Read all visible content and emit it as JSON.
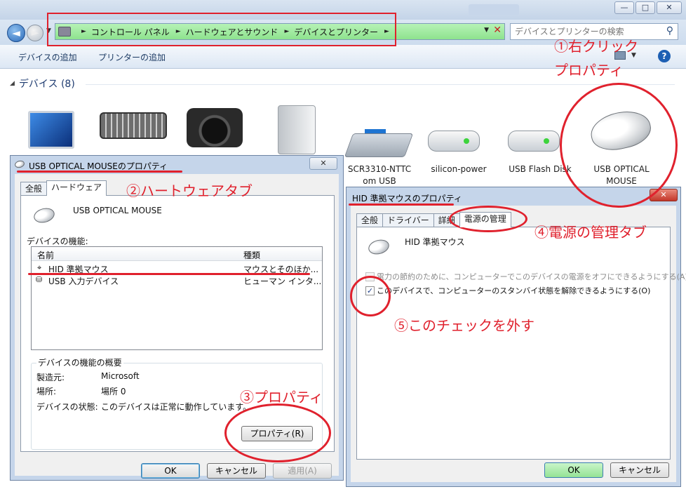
{
  "explorer": {
    "address_crumbs": [
      "コントロール パネル",
      "ハードウェアとサウンド",
      "デバイスとプリンター"
    ],
    "search_placeholder": "デバイスとプリンターの検索",
    "toolbar": {
      "add_device": "デバイスの追加",
      "add_printer": "プリンターの追加"
    },
    "caption": {
      "minimize": "—",
      "maximize": "□",
      "close": "✕"
    },
    "devices_header": "デバイス (8)",
    "devices": [
      {
        "name": "",
        "icon": "monitor-icon"
      },
      {
        "name": "",
        "icon": "keyboard-icon"
      },
      {
        "name": "",
        "icon": "camera-icon"
      },
      {
        "name": "",
        "icon": "external-drive-icon"
      },
      {
        "name": "SCR3310-NTTC\nom USB",
        "icon": "card-reader-icon"
      },
      {
        "name": "silicon-power",
        "icon": "usb-drive-icon"
      },
      {
        "name": "USB Flash Disk",
        "icon": "usb-drive-icon"
      },
      {
        "name": "USB OPTICAL\nMOUSE",
        "icon": "mouse-icon"
      }
    ]
  },
  "dialog1": {
    "title": "USB OPTICAL MOUSEのプロパティ",
    "close": "✕",
    "tabs": [
      "全般",
      "ハードウェア"
    ],
    "device_name": "USB OPTICAL MOUSE",
    "functions_label": "デバイスの機能:",
    "columns": [
      "名前",
      "種類"
    ],
    "rows": [
      {
        "name": "HID 準拠マウス",
        "type": "マウスとそのほか..."
      },
      {
        "name": "USB 入力デバイス",
        "type": "ヒューマン インタ..."
      }
    ],
    "summary_label": "デバイスの機能の概要",
    "summary": [
      {
        "label": "製造元:",
        "value": "Microsoft"
      },
      {
        "label": "場所:",
        "value": "場所 0"
      },
      {
        "label": "デバイスの状態:",
        "value": "このデバイスは正常に動作しています。"
      }
    ],
    "properties_button": "プロパティ(R)",
    "ok": "OK",
    "cancel": "キャンセル",
    "apply": "適用(A)"
  },
  "dialog2": {
    "title": "HID 準拠マウスのプロパティ",
    "close": "✕",
    "tabs": [
      "全般",
      "ドライバー",
      "詳細",
      "電源の管理"
    ],
    "device_name": "HID 準拠マウス",
    "option1": "電力の節約のために、コンピューターでこのデバイスの電源をオフにできるようにする(A)",
    "option1_checked": false,
    "option2": "このデバイスで、コンピューターのスタンバイ状態を解除できるようにする(O)",
    "option2_checked": true,
    "ok": "OK",
    "cancel": "キャンセル"
  },
  "annotations": {
    "step1_line1": "①右クリック",
    "step1_line2": "プロパティ",
    "step2": "②ハートウェアタブ",
    "step3": "③プロパティ",
    "step4": "④電源の管理タブ",
    "step5": "⑤このチェックを外す",
    "color": "#e0212d"
  }
}
